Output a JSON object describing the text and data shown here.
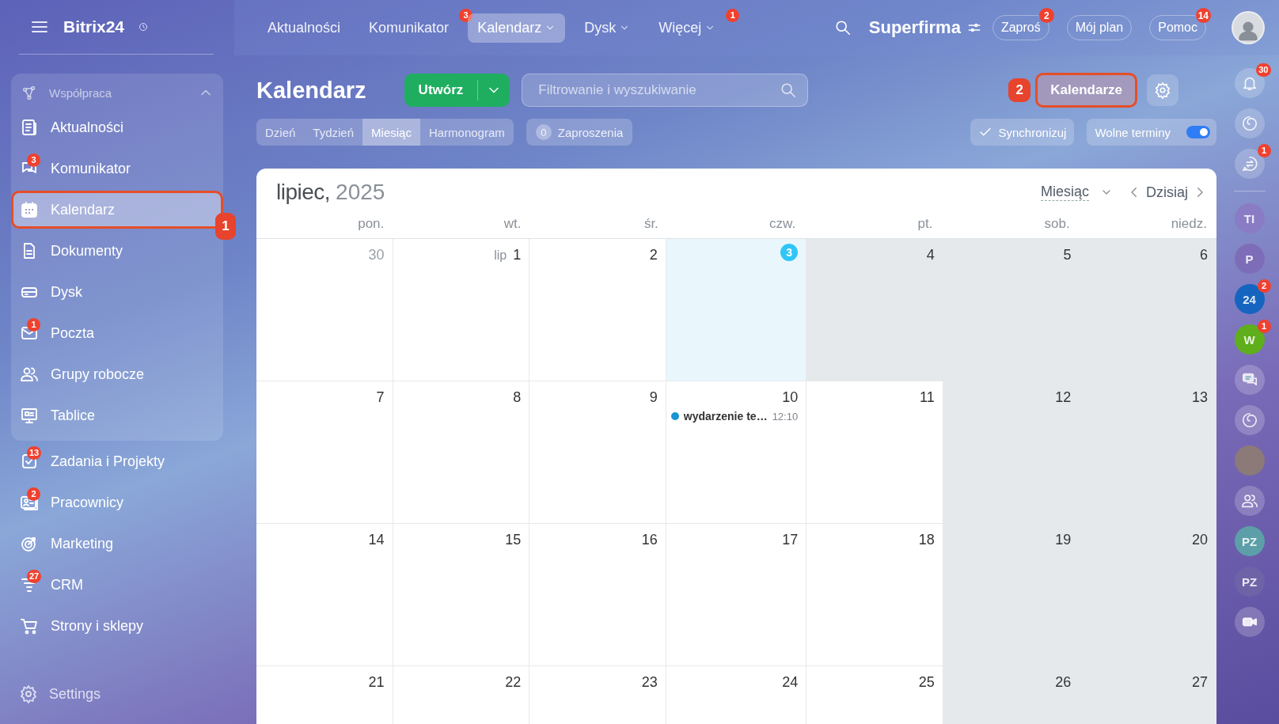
{
  "sidebar": {
    "logo": "Bitrix24",
    "group": {
      "label": "Współpraca",
      "expanded": true,
      "items": [
        {
          "label": "Aktualności",
          "selected": false
        },
        {
          "label": "Komunikator",
          "badge": "3",
          "selected": false
        },
        {
          "label": "Kalendarz",
          "selected": true,
          "callout": "1"
        },
        {
          "label": "Dokumenty",
          "selected": false
        },
        {
          "label": "Dysk",
          "selected": false
        },
        {
          "label": "Poczta",
          "badge": "1",
          "selected": false
        },
        {
          "label": "Grupy robocze",
          "selected": false
        },
        {
          "label": "Tablice",
          "selected": false
        }
      ]
    },
    "items": [
      {
        "label": "Zadania i Projekty",
        "badge": "13",
        "selected": false
      },
      {
        "label": "Pracownicy",
        "badge": "2",
        "selected": false
      },
      {
        "label": "Marketing",
        "selected": false
      },
      {
        "label": "CRM",
        "badge": "27",
        "selected": false
      },
      {
        "label": "Strony i sklepy",
        "selected": false
      }
    ],
    "settings": "Settings"
  },
  "topbar": {
    "nav": [
      {
        "label": "Aktualności",
        "selected": false,
        "dropdown": false
      },
      {
        "label": "Komunikator",
        "badge": "3",
        "selected": false,
        "dropdown": false
      },
      {
        "label": "Kalendarz",
        "selected": true,
        "dropdown": true
      },
      {
        "label": "Dysk",
        "selected": false,
        "dropdown": true
      },
      {
        "label": "Więcej",
        "badge": "1",
        "selected": false,
        "dropdown": true
      }
    ],
    "company": "Superfirma",
    "buttons": [
      {
        "label": "Zaproś",
        "badge": "2"
      },
      {
        "label": "Mój plan"
      },
      {
        "label": "Pomoc",
        "badge": "14"
      }
    ]
  },
  "toolbar": {
    "title": "Kalendarz",
    "create": "Utwórz",
    "search": {
      "placeholder": "Filtrowanie i wyszukiwanie"
    },
    "calendars": {
      "label": "Kalendarze",
      "callout": "2"
    },
    "views": [
      {
        "label": "Dzień",
        "selected": false
      },
      {
        "label": "Tydzień",
        "selected": false
      },
      {
        "label": "Miesiąc",
        "selected": true
      },
      {
        "label": "Harmonogram",
        "selected": false
      }
    ],
    "invitations": {
      "count": "0",
      "label": "Zaproszenia"
    },
    "sync": "Synchronizuj",
    "free_slots": {
      "label": "Wolne terminy",
      "on": true
    }
  },
  "calendar": {
    "month": "lipiec,",
    "year": "2025",
    "view": "Miesiąc",
    "today_button": "Dzisiaj",
    "weekdays": [
      "pon.",
      "wt.",
      "śr.",
      "czw.",
      "pt.",
      "sob.",
      "niedz."
    ],
    "weeks": [
      [
        {
          "day": "30",
          "other_month": true,
          "today": false,
          "shaded": false
        },
        {
          "month": "lip",
          "day": "1",
          "other_month": false,
          "today": false,
          "shaded": false
        },
        {
          "day": "2",
          "other_month": false,
          "today": false,
          "shaded": false
        },
        {
          "day": "3",
          "other_month": false,
          "today": true,
          "shaded": false
        },
        {
          "day": "4",
          "other_month": false,
          "today": false,
          "shaded": true
        },
        {
          "day": "5",
          "other_month": false,
          "today": false,
          "shaded": true
        },
        {
          "day": "6",
          "other_month": false,
          "today": false,
          "shaded": true
        }
      ],
      [
        {
          "day": "7",
          "other_month": false,
          "today": false,
          "shaded": false
        },
        {
          "day": "8",
          "other_month": false,
          "today": false,
          "shaded": false
        },
        {
          "day": "9",
          "other_month": false,
          "today": false,
          "shaded": false
        },
        {
          "day": "10",
          "other_month": false,
          "today": false,
          "shaded": false,
          "events": [
            {
              "title": "wydarzenie te…",
              "time": "12:10",
              "color": "#1a93d2"
            }
          ]
        },
        {
          "day": "11",
          "other_month": false,
          "today": false,
          "shaded": false
        },
        {
          "day": "12",
          "other_month": false,
          "today": false,
          "shaded": true
        },
        {
          "day": "13",
          "other_month": false,
          "today": false,
          "shaded": true
        }
      ],
      [
        {
          "day": "14",
          "other_month": false,
          "today": false,
          "shaded": false
        },
        {
          "day": "15",
          "other_month": false,
          "today": false,
          "shaded": false
        },
        {
          "day": "16",
          "other_month": false,
          "today": false,
          "shaded": false
        },
        {
          "day": "17",
          "other_month": false,
          "today": false,
          "shaded": false
        },
        {
          "day": "18",
          "other_month": false,
          "today": false,
          "shaded": false
        },
        {
          "day": "19",
          "other_month": false,
          "today": false,
          "shaded": true
        },
        {
          "day": "20",
          "other_month": false,
          "today": false,
          "shaded": true
        }
      ],
      [
        {
          "day": "21",
          "other_month": false,
          "today": false,
          "shaded": false
        },
        {
          "day": "22",
          "other_month": false,
          "today": false,
          "shaded": false
        },
        {
          "day": "23",
          "other_month": false,
          "today": false,
          "shaded": false
        },
        {
          "day": "24",
          "other_month": false,
          "today": false,
          "shaded": false
        },
        {
          "day": "25",
          "other_month": false,
          "today": false,
          "shaded": false
        },
        {
          "day": "26",
          "other_month": false,
          "today": false,
          "shaded": true
        },
        {
          "day": "27",
          "other_month": false,
          "today": false,
          "shaded": true
        }
      ]
    ]
  },
  "rail": [
    {
      "kind": "icon",
      "badge": "30"
    },
    {
      "kind": "icon"
    },
    {
      "kind": "icon",
      "badge": "1"
    },
    {
      "kind": "divider"
    },
    {
      "kind": "initials",
      "label": "TI",
      "color": "#8a7cc4"
    },
    {
      "kind": "initials",
      "label": "P",
      "color": "#7d6db8"
    },
    {
      "kind": "initials",
      "label": "24",
      "badge": "2",
      "color": "#1565c0"
    },
    {
      "kind": "initials",
      "label": "W",
      "badge": "1",
      "color": "#5fae1c"
    },
    {
      "kind": "icon"
    },
    {
      "kind": "icon"
    },
    {
      "kind": "photo"
    },
    {
      "kind": "icon"
    },
    {
      "kind": "initials",
      "label": "PZ",
      "color": "#5c9fa8"
    },
    {
      "kind": "initials",
      "label": "PZ",
      "color": "#6f63a8"
    },
    {
      "kind": "icon"
    }
  ]
}
